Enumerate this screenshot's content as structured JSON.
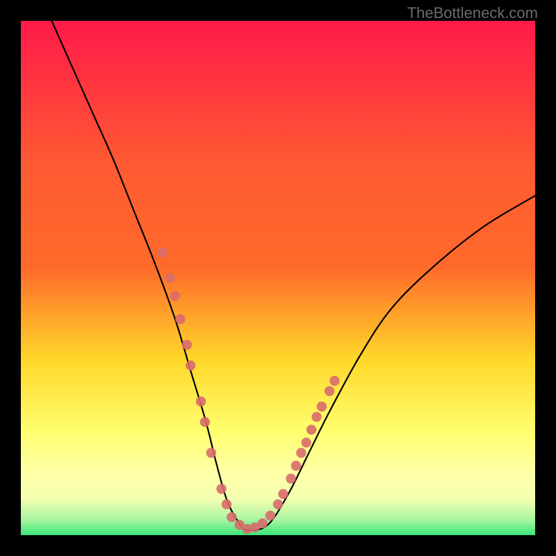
{
  "watermark": "TheBottleneck.com",
  "colors": {
    "background": "#000000",
    "gradient_top": "#ff1a4a",
    "gradient_upper_mid": "#ff6a2a",
    "gradient_mid": "#ffd82a",
    "gradient_lower_mid": "#ffff70",
    "gradient_lower": "#f3ffb0",
    "gradient_bottom": "#3be57a",
    "curve": "#000000",
    "dot": "#d96b6b"
  },
  "chart_data": {
    "type": "line",
    "title": "",
    "xlabel": "",
    "ylabel": "",
    "xlim": [
      0,
      100
    ],
    "ylim": [
      0,
      100
    ],
    "series": [
      {
        "name": "bottleneck-curve",
        "x_pct": [
          6,
          10,
          14,
          18,
          22,
          26,
          30,
          33,
          36,
          38,
          40,
          42,
          44,
          48,
          52,
          56,
          60,
          66,
          72,
          80,
          90,
          100
        ],
        "y_pct": [
          100,
          91,
          82,
          73,
          63,
          53,
          42,
          32,
          22,
          14,
          7,
          3,
          1,
          2,
          8,
          16,
          24,
          35,
          44,
          52,
          60,
          66
        ]
      }
    ],
    "annotations": {
      "type": "scatter",
      "name": "highlight-dots",
      "points_pct": [
        [
          27.5,
          55
        ],
        [
          29,
          50
        ],
        [
          30,
          46.5
        ],
        [
          31,
          42
        ],
        [
          32.3,
          37
        ],
        [
          33,
          33
        ],
        [
          35,
          26
        ],
        [
          35.8,
          22
        ],
        [
          37,
          16
        ],
        [
          39,
          9
        ],
        [
          40,
          6
        ],
        [
          41,
          3.5
        ],
        [
          42.5,
          2
        ],
        [
          44,
          1.2
        ],
        [
          45.5,
          1.5
        ],
        [
          47,
          2.3
        ],
        [
          48.5,
          3.8
        ],
        [
          50,
          6
        ],
        [
          51,
          8
        ],
        [
          52.5,
          11
        ],
        [
          53.5,
          13.5
        ],
        [
          54.5,
          16
        ],
        [
          55.5,
          18
        ],
        [
          56.5,
          20.5
        ],
        [
          57.5,
          23
        ],
        [
          58.5,
          25
        ],
        [
          60,
          28
        ],
        [
          61,
          30
        ]
      ]
    }
  }
}
